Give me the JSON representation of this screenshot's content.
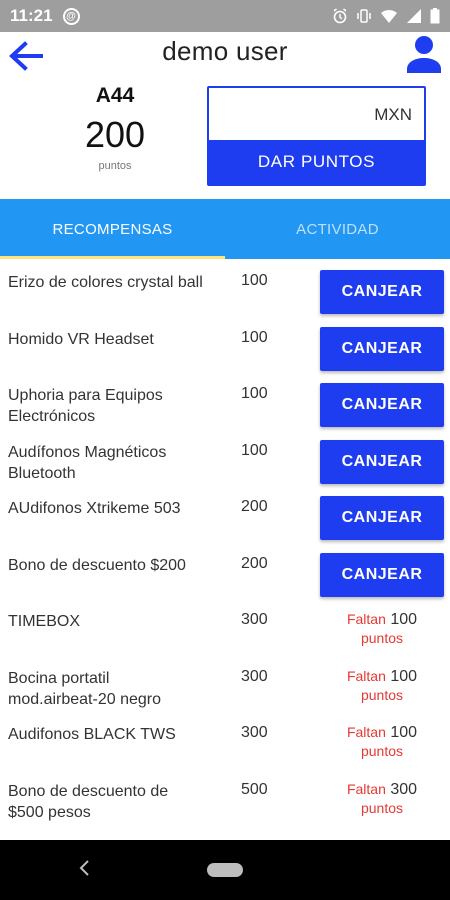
{
  "status_bar": {
    "time": "11:21",
    "notification_icon": "at-sign-icon"
  },
  "header": {
    "title": "demo user",
    "back_icon": "arrow-left-icon",
    "profile_icon": "person-icon"
  },
  "points": {
    "account_code": "A44",
    "value": "200",
    "unit": "puntos"
  },
  "give_points": {
    "currency_placeholder": "MXN",
    "button_label": "DAR PUNTOS"
  },
  "tabs": [
    {
      "label": "RECOMPENSAS",
      "active": true
    },
    {
      "label": "ACTIVIDAD",
      "active": false
    }
  ],
  "rewards": [
    {
      "name": "Erizo de colores crystal ball",
      "cost": "100",
      "action": "CANJEAR"
    },
    {
      "name": "Homido VR Headset",
      "cost": "100",
      "action": "CANJEAR"
    },
    {
      "name": "Uphoria para Equipos Electrónicos",
      "cost": "100",
      "action": "CANJEAR"
    },
    {
      "name": "Audífonos Magnéticos Bluetooth",
      "cost": "100",
      "action": "CANJEAR"
    },
    {
      "name": "AUdifonos Xtrikeme 503",
      "cost": "200",
      "action": "CANJEAR"
    },
    {
      "name": "Bono de descuento $200",
      "cost": "200",
      "action": "CANJEAR"
    },
    {
      "name": "TIMEBOX",
      "cost": "300",
      "missing_label": "Faltan",
      "missing_amount": "100",
      "missing_unit": "puntos"
    },
    {
      "name": "Bocina portatil mod.airbeat-20 negro",
      "cost": "300",
      "missing_label": "Faltan",
      "missing_amount": "100",
      "missing_unit": "puntos"
    },
    {
      "name": "Audifonos BLACK TWS",
      "cost": "300",
      "missing_label": "Faltan",
      "missing_amount": "100",
      "missing_unit": "puntos"
    },
    {
      "name": "Bono de descuento de $500 pesos",
      "cost": "500",
      "missing_label": "Faltan",
      "missing_amount": "300",
      "missing_unit": "puntos"
    }
  ],
  "colors": {
    "primary_blue": "#1f3df0",
    "tab_blue": "#2196f3",
    "tab_indicator": "#ffe57f",
    "missing_red": "#e53935",
    "status_bar_gray": "#9e9e9e"
  }
}
